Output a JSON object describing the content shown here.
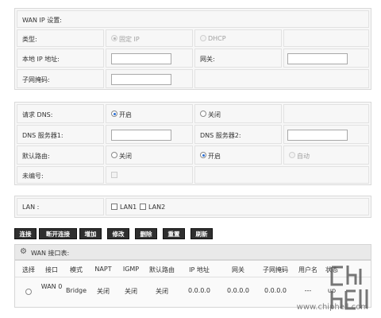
{
  "wan_ip": {
    "section_title": "WAN IP 设置:",
    "type_label": "类型:",
    "static_ip": "固定 IP",
    "dhcp": "DHCP",
    "local_ip_label": "本地 IP 地址:",
    "gateway_label": "网关:",
    "subnet_label": "子网掩码:",
    "local_ip_value": "",
    "gateway_value": "",
    "subnet_value": ""
  },
  "dns": {
    "request_label": "请求 DNS:",
    "on": "开启",
    "off": "关闭",
    "server1_label": "DNS 服务器1:",
    "server2_label": "DNS 服务器2:",
    "server1_value": "",
    "server2_value": "",
    "default_route_label": "默认路由:",
    "route_off": "关闭",
    "route_on": "开启",
    "route_auto": "自动",
    "unnumbered_label": "未编号:"
  },
  "lan": {
    "label": "LAN :",
    "lan1": "LAN1",
    "lan2": "LAN2"
  },
  "buttons": {
    "connect": "连接",
    "disconnect": "断开连接",
    "add": "增加",
    "modify": "修改",
    "delete": "删除",
    "reset": "重置",
    "refresh": "刷新"
  },
  "wan_table": {
    "title": "WAN 接口表:",
    "columns": [
      "选择",
      "接口",
      "模式",
      "NAPT",
      "IGMP",
      "默认路由",
      "IP 地址",
      "网关",
      "子网掩码",
      "用户名",
      "状态"
    ],
    "row": [
      "",
      "WAN 0",
      "Bridge",
      "关闭",
      "关闭",
      "关闭",
      "0.0.0.0",
      "0.0.0.0",
      "0.0.0.0",
      "---",
      "up"
    ]
  },
  "watermark": "www.chiphell.com",
  "colors": {
    "button_bg": "#2f2f2f",
    "panel_bg": "#f7f7f7",
    "radio_selected": "#2b6fd6"
  }
}
